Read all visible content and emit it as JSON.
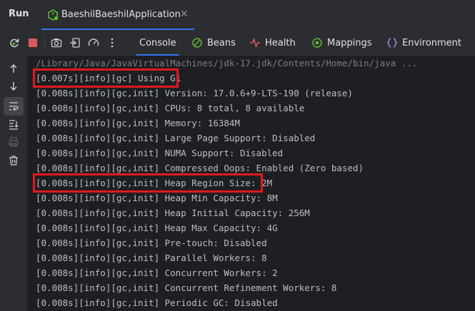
{
  "titlebar": {
    "run_label": "Run",
    "run_config_name": "BaeshilBaeshilApplication"
  },
  "toolbar": {
    "tabs": [
      {
        "label": "Console"
      },
      {
        "label": "Beans"
      },
      {
        "label": "Health"
      },
      {
        "label": "Mappings"
      },
      {
        "label": "Environment"
      }
    ]
  },
  "console": {
    "command_line": "/Library/Java/JavaVirtualMachines/jdk-17.jdk/Contents/Home/bin/java ...",
    "lines": [
      "[0.007s][info][gc] Using G1",
      "[0.008s][info][gc,init] Version: 17.0.6+9-LTS-190 (release)",
      "[0.008s][info][gc,init] CPUs: 8 total, 8 available",
      "[0.008s][info][gc,init] Memory: 16384M",
      "[0.008s][info][gc,init] Large Page Support: Disabled",
      "[0.008s][info][gc,init] NUMA Support: Disabled",
      "[0.008s][info][gc,init] Compressed Oops: Enabled (Zero based)",
      "[0.008s][info][gc,init] Heap Region Size: 2M",
      "[0.008s][info][gc,init] Heap Min Capacity: 8M",
      "[0.008s][info][gc,init] Heap Initial Capacity: 256M",
      "[0.008s][info][gc,init] Heap Max Capacity: 4G",
      "[0.008s][info][gc,init] Pre-touch: Disabled",
      "[0.008s][info][gc,init] Parallel Workers: 8",
      "[0.008s][info][gc,init] Concurrent Workers: 2",
      "[0.008s][info][gc,init] Concurrent Refinement Workers: 8",
      "[0.008s][info][gc,init] Periodic GC: Disabled"
    ],
    "highlighted_lines": [
      0,
      7
    ]
  },
  "colors": {
    "highlight": "#e3191d",
    "accent": "#3574f0",
    "console_bg": "#1e1f22",
    "panel_bg": "#2b2d30"
  },
  "icons": {
    "toolbar": [
      "rerun-icon",
      "stop-icon",
      "screenshot-icon",
      "exit-icon",
      "performance-icon",
      "more-icon"
    ],
    "gutter": [
      "up-arrow-icon",
      "down-arrow-icon",
      "soft-wrap-icon",
      "scroll-to-end-icon",
      "print-icon",
      "clear-icon"
    ]
  }
}
